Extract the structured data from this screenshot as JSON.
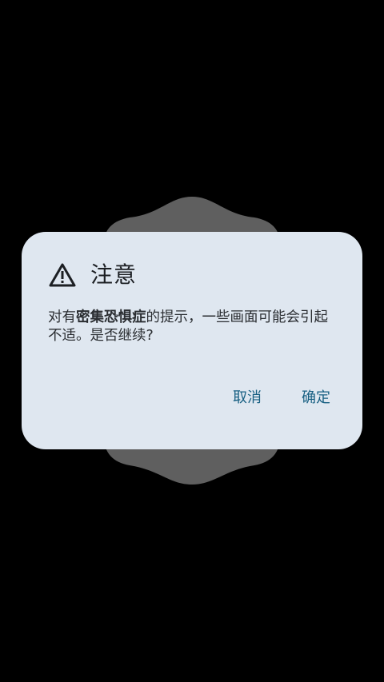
{
  "dialog": {
    "icon": "warning-triangle-icon",
    "title": "注意",
    "message_prefix": "对有",
    "message_bold": "密集恐惧症",
    "message_suffix": "的提示，一些画面可能会引起不适。是否继续?",
    "cancel_label": "取消",
    "confirm_label": "确定"
  },
  "colors": {
    "background": "#000000",
    "backdrop_shape": "#5f5f5f",
    "dialog_surface": "#dfe7f0",
    "action_text": "#175f82",
    "title_text": "#1c1f23"
  }
}
